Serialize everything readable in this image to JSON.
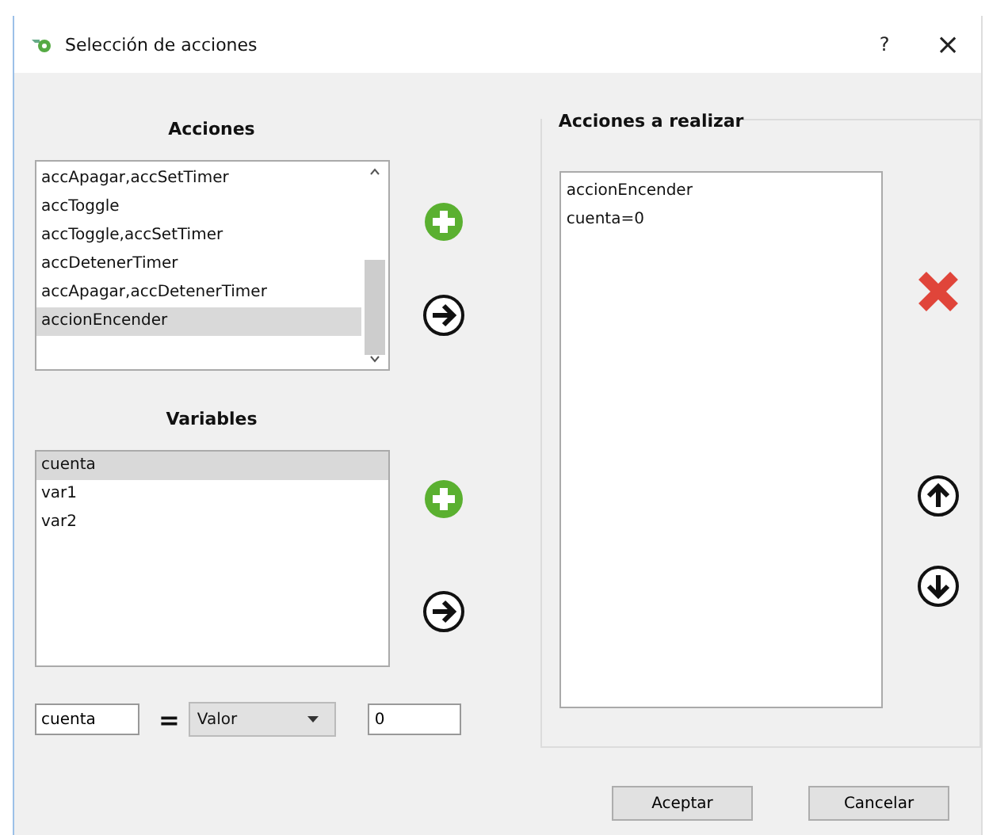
{
  "window": {
    "title": "Selección de acciones",
    "help": "?",
    "close": "×"
  },
  "acciones": {
    "heading": "Acciones",
    "items": [
      {
        "label": "accApagar,accSetTimer",
        "selected": false
      },
      {
        "label": "accToggle",
        "selected": false
      },
      {
        "label": "accToggle,accSetTimer",
        "selected": false
      },
      {
        "label": "accDetenerTimer",
        "selected": false
      },
      {
        "label": "accApagar,accDetenerTimer",
        "selected": false
      },
      {
        "label": "accionEncender",
        "selected": true
      }
    ]
  },
  "variables": {
    "heading": "Variables",
    "items": [
      {
        "label": "cuenta",
        "selected": true
      },
      {
        "label": "var1",
        "selected": false
      },
      {
        "label": "var2",
        "selected": false
      }
    ]
  },
  "assignment": {
    "variable": "cuenta",
    "operator": "=",
    "source": "Valor",
    "value": "0"
  },
  "acciones_a_realizar": {
    "title": "Acciones a realizar",
    "items": [
      {
        "label": "accionEncender"
      },
      {
        "label": "cuenta=0"
      }
    ]
  },
  "buttons": [
    "Aceptar",
    "Cancelar"
  ]
}
